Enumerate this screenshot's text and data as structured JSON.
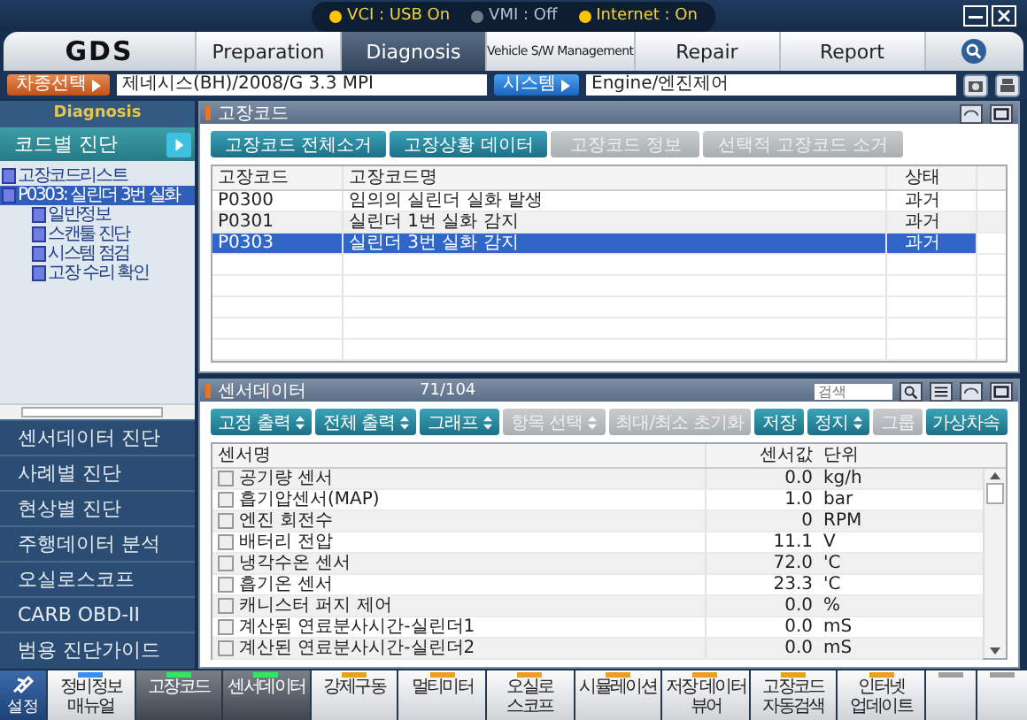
{
  "status": [
    {
      "label": "VCI : USB On",
      "on": true
    },
    {
      "label": "VMI : Off",
      "on": false
    },
    {
      "label": "Internet : On",
      "on": true
    }
  ],
  "logo": "GDS",
  "tabs": [
    {
      "label": "Preparation",
      "selected": false
    },
    {
      "label": "Diagnosis",
      "selected": true
    },
    {
      "label": "Vehicle S/W Management",
      "selected": false
    },
    {
      "label": "Repair",
      "selected": false
    },
    {
      "label": "Report",
      "selected": false
    }
  ],
  "vehicle": {
    "button": "차종선택",
    "value": "제네시스(BH)/2008/G 3.3 MPI",
    "system_button": "시스템",
    "system_value": "Engine/엔진제어"
  },
  "sidebar": {
    "title": "Diagnosis",
    "active": "코드별 진단",
    "tree": [
      {
        "label": "고장코드리스트",
        "selected": false
      },
      {
        "label": "P0303: 실린더 3번 실화",
        "selected": true,
        "children": [
          {
            "label": "일반정보",
            "selected": false
          },
          {
            "label": "스캔툴 진단",
            "selected": false
          },
          {
            "label": "시스템 점검",
            "selected": false
          },
          {
            "label": "고장 수리 확인",
            "selected": false
          }
        ]
      }
    ],
    "menu": [
      "센서데이터 진단",
      "사례별 진단",
      "현상별 진단",
      "주행데이터 분석",
      "오실로스코프",
      "CARB OBD-II",
      "범용 진단가이드"
    ]
  },
  "dtc": {
    "title": "고장코드",
    "buttons": [
      {
        "label": "고장코드 전체소거",
        "disabled": false
      },
      {
        "label": "고장상황 데이터",
        "disabled": false
      },
      {
        "label": "고장코드 정보",
        "disabled": true
      },
      {
        "label": "선택적 고장코드 소거",
        "disabled": true
      }
    ],
    "columns": [
      "고장코드",
      "고장코드명",
      "상태"
    ],
    "rows": [
      {
        "code": "P0300",
        "name": "임의의 실린더 실화 발생",
        "state": "과거",
        "selected": false
      },
      {
        "code": "P0301",
        "name": "실린더 1번 실화 감지",
        "state": "과거",
        "selected": false
      },
      {
        "code": "P0303",
        "name": "실린더 3번 실화 감지",
        "state": "과거",
        "selected": true
      }
    ]
  },
  "sensor": {
    "title": "센서데이터",
    "count": "71/104",
    "search": {
      "placeholder": "검색"
    },
    "buttons": [
      {
        "label": "고정 출력",
        "dropdown": true,
        "disabled": false
      },
      {
        "label": "전체 출력",
        "dropdown": true,
        "disabled": false
      },
      {
        "label": "그래프",
        "dropdown": true,
        "disabled": false
      },
      {
        "label": "항목 선택",
        "dropdown": true,
        "disabled": true
      },
      {
        "label": "최대/최소 초기화",
        "dropdown": false,
        "disabled": true
      },
      {
        "label": "저장",
        "dropdown": false,
        "disabled": false
      },
      {
        "label": "정지",
        "dropdown": true,
        "disabled": false
      },
      {
        "label": "그룹",
        "dropdown": false,
        "disabled": true
      },
      {
        "label": "가상차속",
        "dropdown": false,
        "disabled": false
      }
    ],
    "columns": [
      "센서명",
      "센서값",
      "단위"
    ],
    "rows": [
      {
        "name": "공기량 센서",
        "value": "0.0",
        "unit": "kg/h",
        "checked": false
      },
      {
        "name": "흡기압센서(MAP)",
        "value": "1.0",
        "unit": "bar",
        "checked": false
      },
      {
        "name": "엔진 회전수",
        "value": "0",
        "unit": "RPM",
        "checked": false
      },
      {
        "name": "배터리 전압",
        "value": "11.1",
        "unit": "V",
        "checked": false
      },
      {
        "name": "냉각수온 센서",
        "value": "72.0",
        "unit": "'C",
        "checked": false
      },
      {
        "name": "흡기온 센서",
        "value": "23.3",
        "unit": "'C",
        "checked": false
      },
      {
        "name": "캐니스터 퍼지 제어",
        "value": "0.0",
        "unit": "%",
        "checked": false
      },
      {
        "name": "계산된 연료분사시간-실린더1",
        "value": "0.0",
        "unit": "mS",
        "checked": false
      },
      {
        "name": "계산된 연료분사시간-실린더2",
        "value": "0.0",
        "unit": "mS",
        "checked": false
      }
    ]
  },
  "bottom": {
    "settings": "설정",
    "buttons": [
      {
        "label": "정비정보 매뉴얼",
        "color": "#3a8ee8",
        "selected": false
      },
      {
        "label": "고장코드",
        "color": "#2ee860",
        "selected": true
      },
      {
        "label": "센서데이터",
        "color": "#2ee860",
        "selected": true
      },
      {
        "label": "강제구동",
        "color": "#e8a020",
        "selected": false
      },
      {
        "label": "멀티미터",
        "color": "#e8a020",
        "selected": false
      },
      {
        "label": "오실로 스코프",
        "color": "#e8a020",
        "selected": false
      },
      {
        "label": "시뮬레이션",
        "color": "#e8a020",
        "selected": false
      },
      {
        "label": "저장 데이터 뷰어",
        "color": "#e8a020",
        "selected": false
      },
      {
        "label": "고장코드 자동검색",
        "color": "#e8a020",
        "selected": false
      },
      {
        "label": "인터넷 업데이트",
        "color": "#e8a020",
        "selected": false
      },
      {
        "color": "#a0a0a0",
        "selected": false
      },
      {
        "color": "#a0a0a0",
        "selected": false
      }
    ]
  }
}
